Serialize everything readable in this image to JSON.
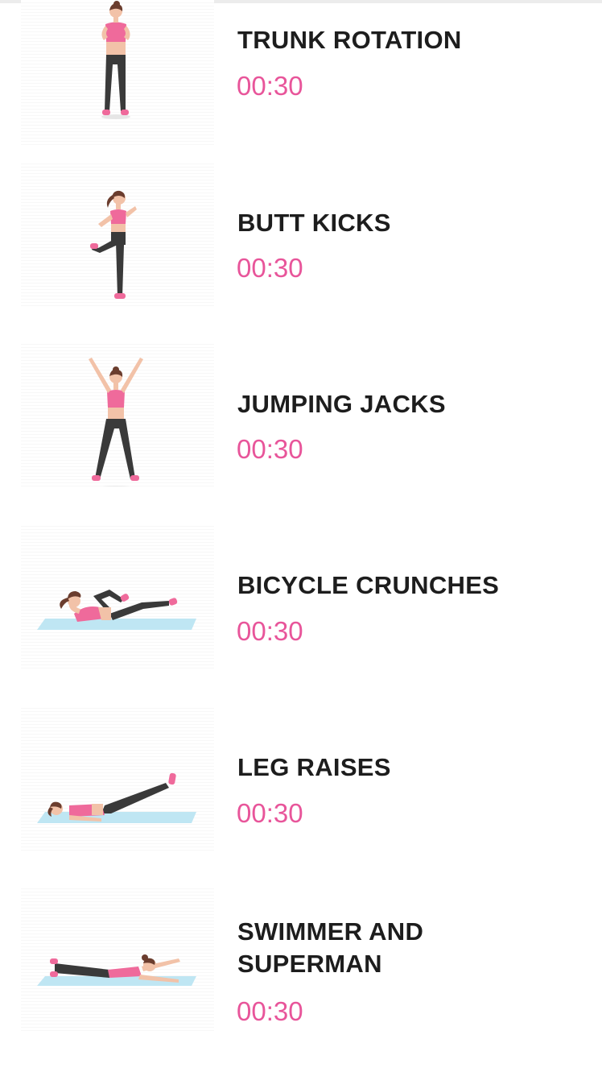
{
  "exercises": [
    {
      "name": "TRUNK ROTATION",
      "duration": "00:30",
      "illustration": "standing-woman-icon"
    },
    {
      "name": "BUTT KICKS",
      "duration": "00:30",
      "illustration": "butt-kick-woman-icon"
    },
    {
      "name": "JUMPING JACKS",
      "duration": "00:30",
      "illustration": "jumping-jack-woman-icon"
    },
    {
      "name": "BICYCLE CRUNCHES",
      "duration": "00:30",
      "illustration": "bicycle-crunch-woman-icon"
    },
    {
      "name": "LEG RAISES",
      "duration": "00:30",
      "illustration": "leg-raise-woman-icon"
    },
    {
      "name": "SWIMMER AND SUPERMAN",
      "name_line1": "SWIMMER AND",
      "name_line2": "SUPERMAN",
      "duration": "00:30",
      "illustration": "superman-woman-icon"
    }
  ],
  "colors": {
    "accent": "#e8559a",
    "title_text": "#1d1d1d",
    "top_pink": "#ef6a9b",
    "leggings": "#3a3a3a",
    "skin": "#f2c2a8",
    "mat": "#bfe6f3"
  }
}
